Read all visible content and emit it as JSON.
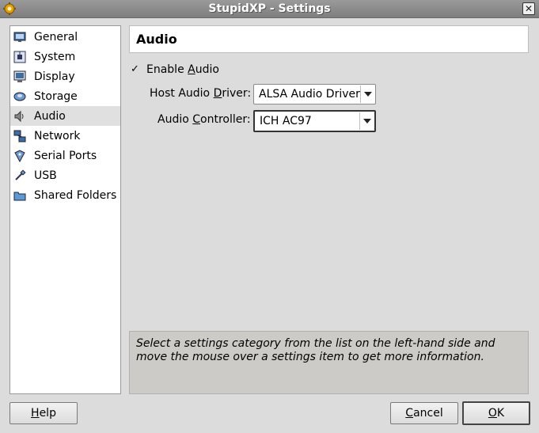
{
  "window": {
    "title": "StupidXP - Settings",
    "close_label": "✕"
  },
  "sidebar": {
    "items": [
      {
        "label": "General",
        "icon": "monitor-icon"
      },
      {
        "label": "System",
        "icon": "motherboard-icon"
      },
      {
        "label": "Display",
        "icon": "display-icon"
      },
      {
        "label": "Storage",
        "icon": "disk-icon"
      },
      {
        "label": "Audio",
        "icon": "speaker-icon",
        "selected": true
      },
      {
        "label": "Network",
        "icon": "network-icon"
      },
      {
        "label": "Serial Ports",
        "icon": "serial-port-icon"
      },
      {
        "label": "USB",
        "icon": "usb-icon"
      },
      {
        "label": "Shared Folders",
        "icon": "folder-icon"
      }
    ]
  },
  "page": {
    "title": "Audio",
    "enable_audio": {
      "checked": true,
      "label_pre": "Enable ",
      "label_u": "A",
      "label_post": "udio"
    },
    "host_driver": {
      "label_pre": "Host Audio ",
      "label_u": "D",
      "label_post": "river:",
      "value": "ALSA Audio Driver"
    },
    "controller": {
      "label_pre": "Audio ",
      "label_u": "C",
      "label_post": "ontroller:",
      "value": "ICH AC97"
    }
  },
  "info": {
    "text": "Select a settings category from the list on the left-hand side and move the mouse over a settings item to get more information."
  },
  "buttons": {
    "help_u": "H",
    "help_post": "elp",
    "cancel_u": "C",
    "cancel_post": "ancel",
    "ok_u": "O",
    "ok_post": "K"
  },
  "colors": {
    "window_bg": "#dcdcdc",
    "titlebar": "#8c8c8c",
    "selected_item": "#e0e0e0",
    "info_bg": "#cdcbc8"
  }
}
